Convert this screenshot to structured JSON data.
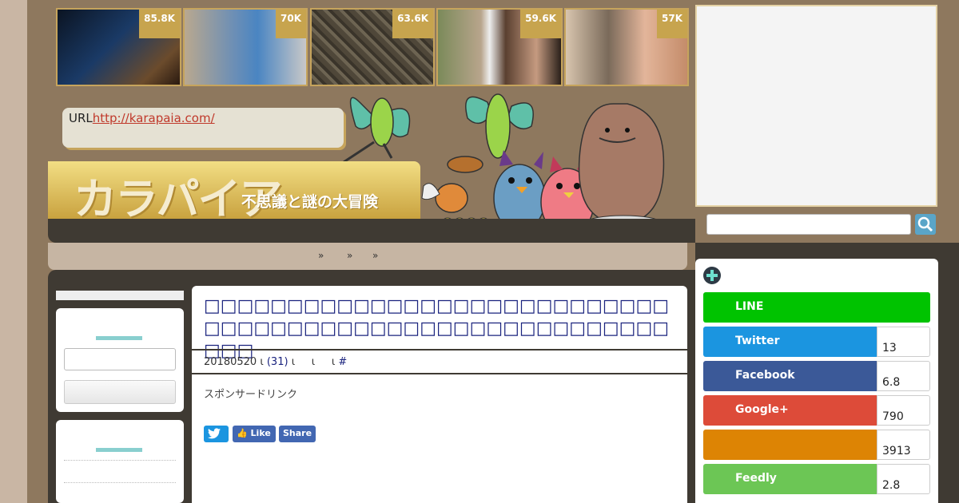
{
  "thumbnails": [
    {
      "count": "85.8K",
      "color": "#1b2535"
    },
    {
      "count": "70K",
      "color": "#7c8fa3"
    },
    {
      "count": "63.6K",
      "color": "#5d5546"
    },
    {
      "count": "59.6K",
      "color": "#8a8b6a"
    },
    {
      "count": "57K",
      "color": "#b5a58f"
    }
  ],
  "header": {
    "url_label": "URL",
    "url": "http://karapaia.com/",
    "logo_text": "カラパイア",
    "tagline": "不思議と謎の大冒険"
  },
  "nav": {
    "separators": [
      "»",
      "»",
      "»"
    ]
  },
  "article": {
    "title": "□□□□□□□□□□□□□□□□□□□□□□□□□□□□□□□□□□□□□□□□□□□□□□□□□□□□□□□□□□□",
    "date": "20180520",
    "sep1": "ι",
    "comments": "(31)",
    "sep2": "ι",
    "sep3": "ι",
    "sep4": "ι",
    "hash": "#",
    "sponsor": "スポンサードリンク",
    "share_like": "Like",
    "share_share": "Share"
  },
  "share_panel": {
    "items": [
      {
        "label": "LINE",
        "count": "",
        "color": "#00c300"
      },
      {
        "label": "Twitter",
        "count": "13",
        "color": "#1b95e0"
      },
      {
        "label": "Facebook",
        "count": "6.8",
        "color": "#3b5998"
      },
      {
        "label": "Google+",
        "count": "790",
        "color": "#dd4b39"
      },
      {
        "label": "",
        "count": "3913",
        "color": "#dd8404"
      },
      {
        "label": "Feedly",
        "count": "2.8",
        "color": "#6cc655"
      }
    ]
  }
}
